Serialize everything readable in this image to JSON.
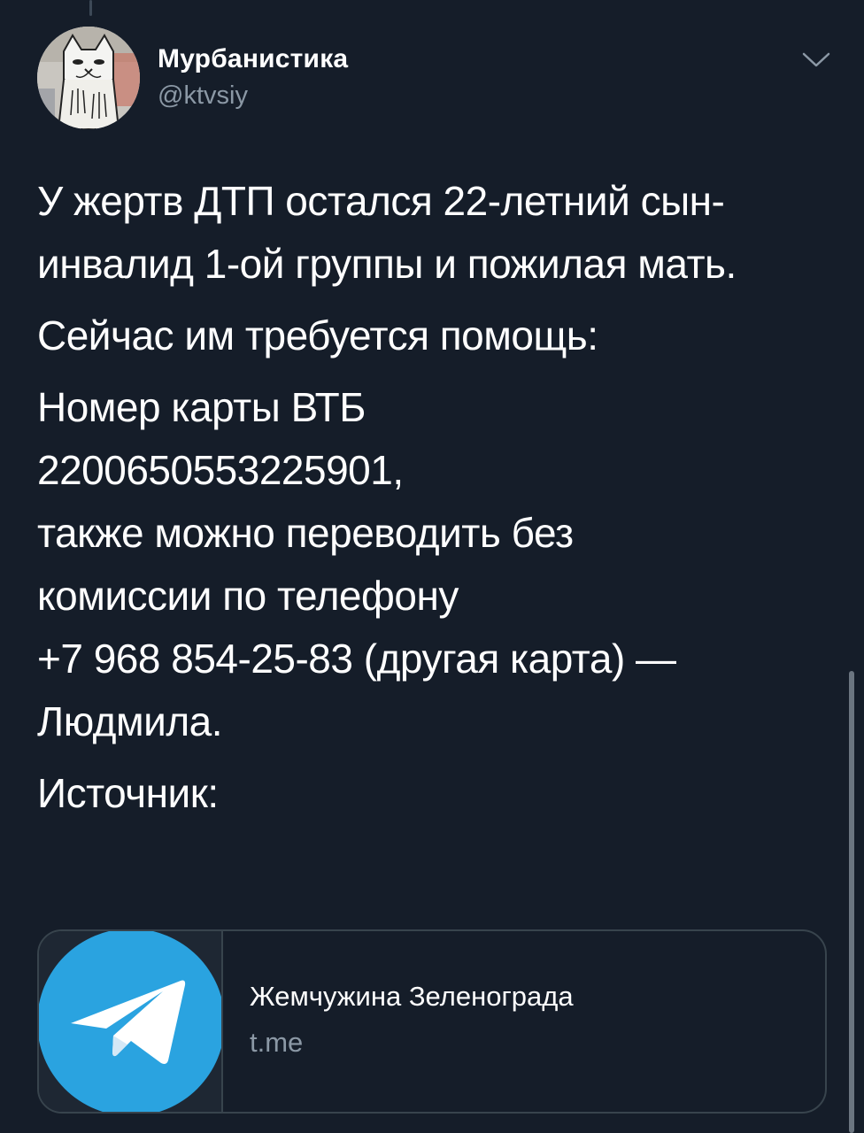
{
  "author": {
    "name": "Мурбанистика",
    "handle": "@ktvsiy"
  },
  "icons": {
    "menu": "chevron-down-icon",
    "card_thumbnail": "telegram-icon"
  },
  "tweet": {
    "paragraph_1": {
      "line_1": "У жертв ДТП остался 22-летний сын-",
      "line_2": "инвалид 1-ой группы и пожилая мать."
    },
    "paragraph_2": {
      "line_1": "Сейчас им требуется помощь:"
    },
    "paragraph_3": {
      "line_1": "Номер карты ВТБ",
      "line_2": "2200650553225901,",
      "line_3": "также можно переводить без",
      "line_4": "комиссии по телефону",
      "line_5": "+7 968 854-25-83 (другая карта) —",
      "line_6": "Людмила."
    },
    "paragraph_4": {
      "line_1": "Источник:"
    }
  },
  "link_card": {
    "title": "Жемчужина Зеленограда",
    "domain": "t.me"
  },
  "colors": {
    "background": "#151d29",
    "secondary_text": "#8b98a5",
    "border": "#38444d",
    "telegram_blue": "#2aa3e0"
  }
}
